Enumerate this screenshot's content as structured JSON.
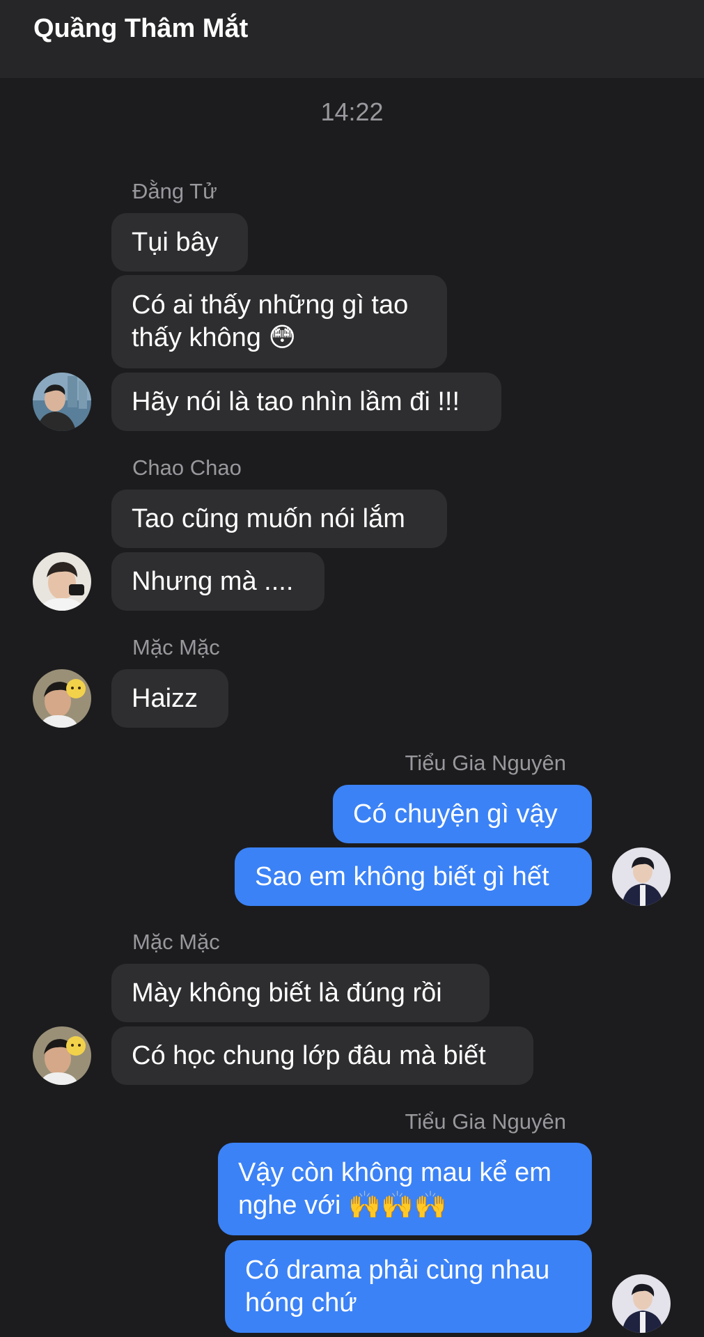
{
  "header": {
    "title": "Quầng Thâm Mắt"
  },
  "chat": {
    "timestamp": "14:22",
    "groups": [
      {
        "sender": "Đằng Tử",
        "messages": [
          "Tụi bây",
          "Có ai thấy những gì tao\nthấy không 😳",
          "Hãy nói là tao nhìn lầm đi !!!"
        ]
      },
      {
        "sender": "Chao Chao",
        "messages": [
          "Tao cũng muốn nói lắm",
          "Nhưng mà ...."
        ]
      },
      {
        "sender": "Mặc Mặc",
        "messages": [
          "Haizz"
        ]
      },
      {
        "sender": "Tiểu Gia Nguyên",
        "messages": [
          "Có chuyện gì vậy",
          "Sao em không biết gì hết"
        ]
      },
      {
        "sender": "Mặc Mặc",
        "messages": [
          "Mày không biết là đúng rồi",
          "Có học chung lớp đâu mà biết"
        ]
      },
      {
        "sender": "Tiểu Gia Nguyên",
        "messages": [
          "Vậy còn không mau kể em\nnghe với 🙌🙌🙌",
          "Có drama phải cùng nhau\nhóng chứ"
        ]
      }
    ]
  },
  "colors": {
    "background": "#1c1c1e",
    "header": "#262628",
    "incoming_bubble": "#2e2e30",
    "outgoing_bubble": "#3b82f6",
    "sender_text": "#98989d"
  }
}
